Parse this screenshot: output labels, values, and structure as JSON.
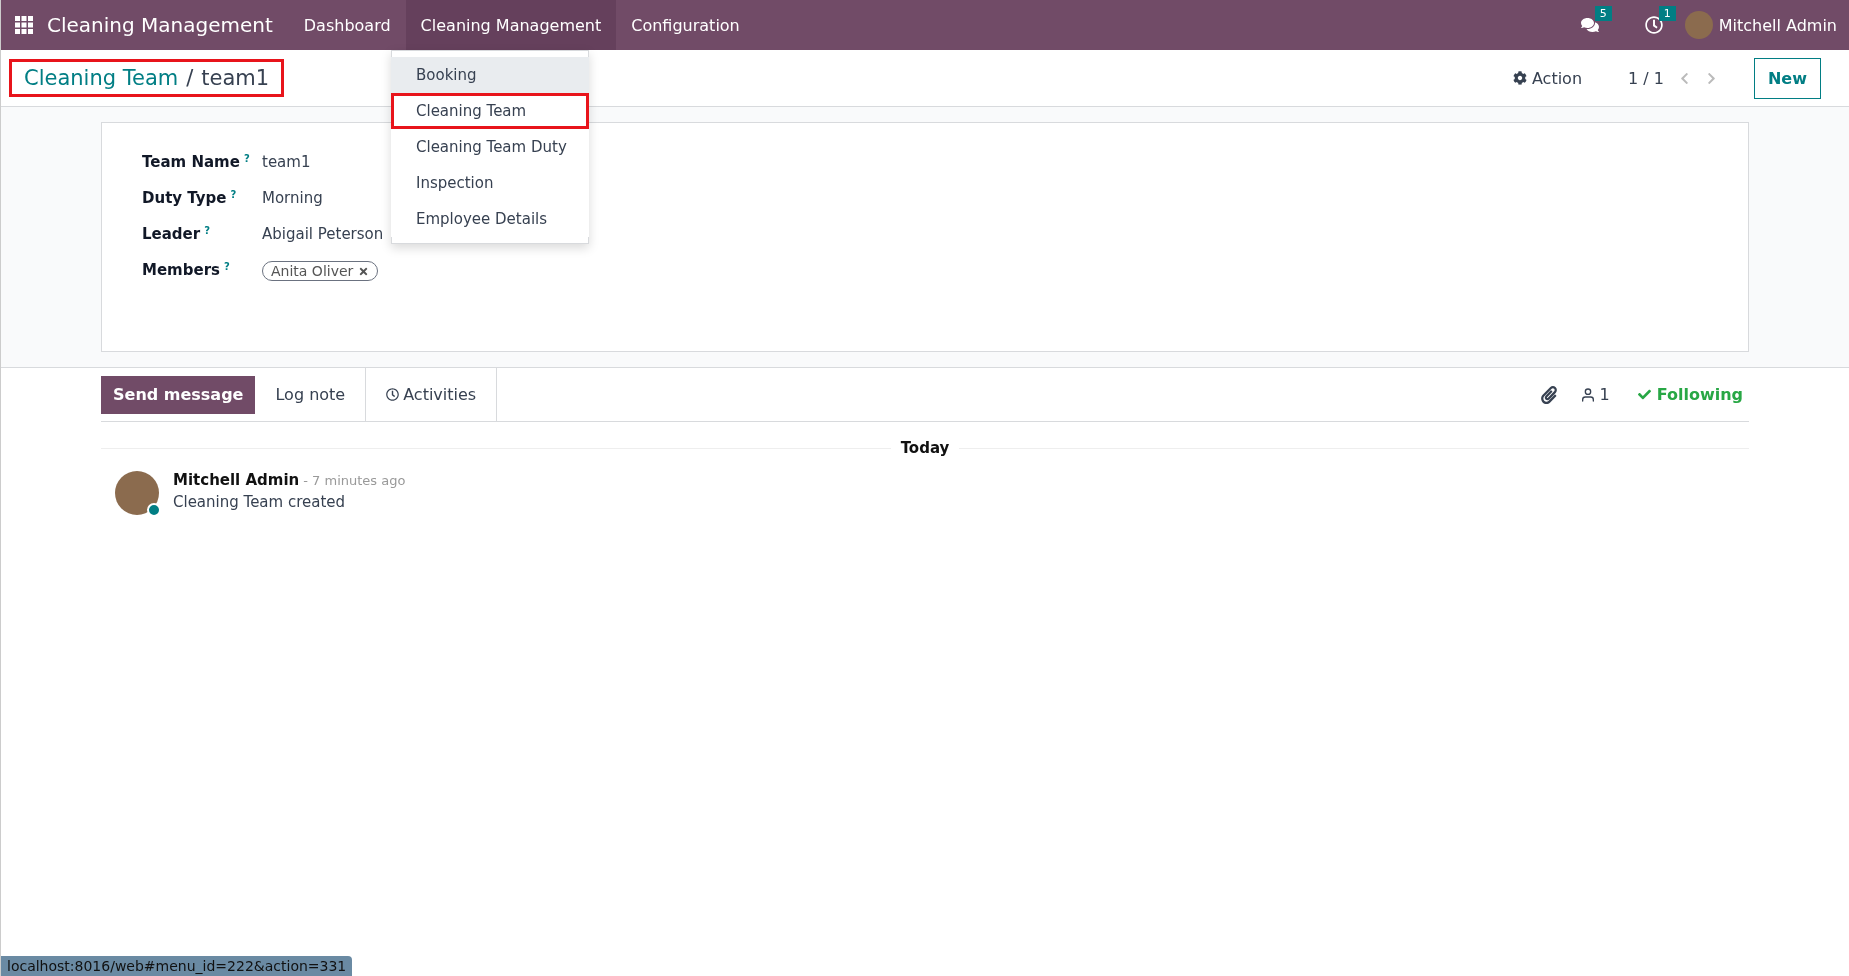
{
  "navbar": {
    "app_name": "Cleaning Management",
    "menus": [
      {
        "label": "Dashboard",
        "selected": false
      },
      {
        "label": "Cleaning Management",
        "selected": true
      },
      {
        "label": "Configuration",
        "selected": false
      }
    ],
    "messages_count": "5",
    "activities_count": "1",
    "user": "Mitchell Admin"
  },
  "dropdown": {
    "items": [
      {
        "label": "Booking",
        "hovered": true,
        "highlighted": false
      },
      {
        "label": "Cleaning Team",
        "hovered": false,
        "highlighted": true
      },
      {
        "label": "Cleaning Team Duty",
        "hovered": false,
        "highlighted": false
      },
      {
        "label": "Inspection",
        "hovered": false,
        "highlighted": false
      },
      {
        "label": "Employee Details",
        "hovered": false,
        "highlighted": false
      }
    ]
  },
  "breadcrumb": {
    "parent": "Cleaning Team",
    "separator": "/",
    "current": "team1",
    "highlighted": true
  },
  "control_panel": {
    "action": "Action",
    "pager": "1 / 1",
    "new_button": "New"
  },
  "form": {
    "fields": [
      {
        "label": "Team Name",
        "help": "?",
        "kind": "text",
        "value": "team1"
      },
      {
        "label": "Duty Type",
        "help": "?",
        "kind": "text",
        "value": "Morning"
      },
      {
        "label": "Leader",
        "help": "?",
        "kind": "text",
        "value": "Abigail Peterson"
      },
      {
        "label": "Members",
        "help": "?",
        "kind": "tags",
        "tags": [
          "Anita Oliver"
        ]
      }
    ]
  },
  "chatter": {
    "send_message": "Send message",
    "log_note": "Log note",
    "activities": "Activities",
    "followers_count": "1",
    "following": "Following",
    "date_separator": "Today",
    "messages": [
      {
        "author": "Mitchell Admin",
        "time": "- 7 minutes ago",
        "body": "Cleaning Team created"
      }
    ]
  },
  "status_bar": "localhost:8016/web#menu_id=222&action=331"
}
